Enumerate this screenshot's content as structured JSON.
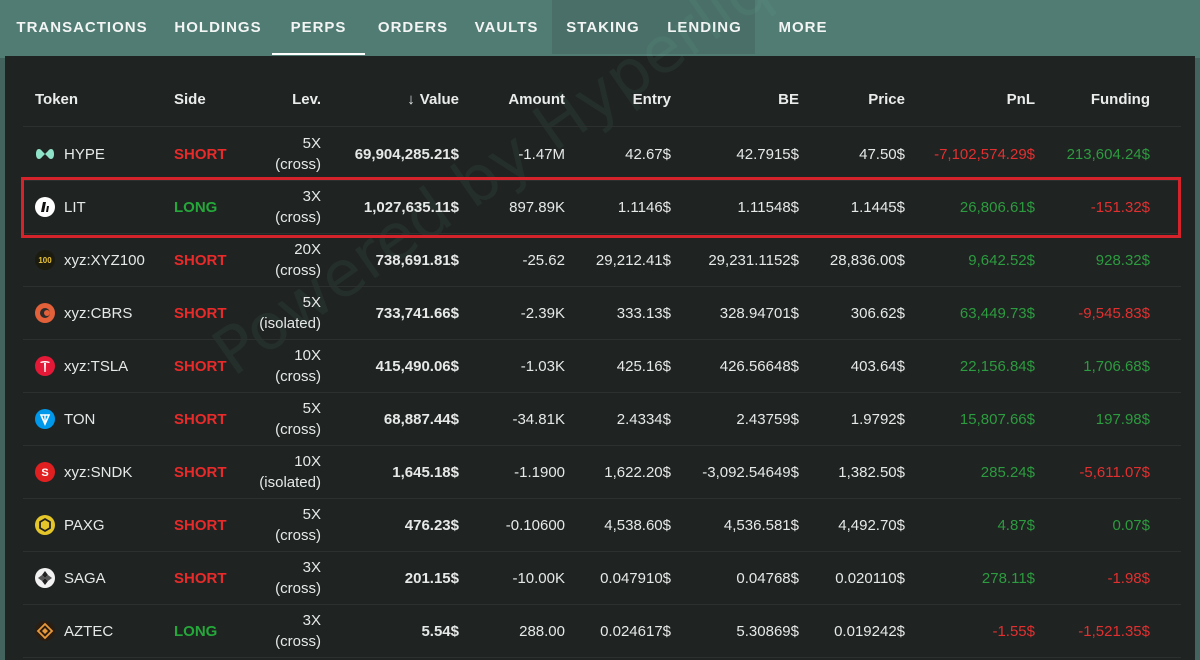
{
  "tabs": [
    {
      "label": "TRANSACTIONS"
    },
    {
      "label": "HOLDINGS"
    },
    {
      "label": "PERPS"
    },
    {
      "label": "ORDERS"
    },
    {
      "label": "VAULTS"
    },
    {
      "label": "STAKING"
    },
    {
      "label": "LENDING"
    },
    {
      "label": "MORE"
    }
  ],
  "active_tab": "PERPS",
  "watermark": "Powered by Hyperliquid",
  "columns": {
    "token": "Token",
    "side": "Side",
    "lev": "Lev.",
    "value": "Value",
    "amount": "Amount",
    "entry": "Entry",
    "be": "BE",
    "price": "Price",
    "pnl": "PnL",
    "funding": "Funding"
  },
  "colors": {
    "short": "#e82a2a",
    "long": "#25a83a",
    "highlight": "#d4232a"
  },
  "rows": [
    {
      "token": "HYPE",
      "icon": "hype-icon",
      "side": "SHORT",
      "lev": "5X",
      "mode": "(cross)",
      "value": "69,904,285.21$",
      "amount": "-1.47M",
      "entry": "42.67$",
      "be": "42.7915$",
      "price": "47.50$",
      "pnl": "-7,102,574.29$",
      "funding": "213,604.24$"
    },
    {
      "token": "LIT",
      "icon": "lit-icon",
      "side": "LONG",
      "lev": "3X",
      "mode": "(cross)",
      "value": "1,027,635.11$",
      "amount": "897.89K",
      "entry": "1.1146$",
      "be": "1.11548$",
      "price": "1.1445$",
      "pnl": "26,806.61$",
      "funding": "-151.32$"
    },
    {
      "token": "xyz:XYZ100",
      "icon": "xyz100-icon",
      "side": "SHORT",
      "lev": "20X",
      "mode": "(cross)",
      "value": "738,691.81$",
      "amount": "-25.62",
      "entry": "29,212.41$",
      "be": "29,231.1152$",
      "price": "28,836.00$",
      "pnl": "9,642.52$",
      "funding": "928.32$"
    },
    {
      "token": "xyz:CBRS",
      "icon": "cbrs-icon",
      "side": "SHORT",
      "lev": "5X",
      "mode": "(isolated)",
      "value": "733,741.66$",
      "amount": "-2.39K",
      "entry": "333.13$",
      "be": "328.94701$",
      "price": "306.62$",
      "pnl": "63,449.73$",
      "funding": "-9,545.83$"
    },
    {
      "token": "xyz:TSLA",
      "icon": "tesla-icon",
      "side": "SHORT",
      "lev": "10X",
      "mode": "(cross)",
      "value": "415,490.06$",
      "amount": "-1.03K",
      "entry": "425.16$",
      "be": "426.56648$",
      "price": "403.64$",
      "pnl": "22,156.84$",
      "funding": "1,706.68$"
    },
    {
      "token": "TON",
      "icon": "ton-icon",
      "side": "SHORT",
      "lev": "5X",
      "mode": "(cross)",
      "value": "68,887.44$",
      "amount": "-34.81K",
      "entry": "2.4334$",
      "be": "2.43759$",
      "price": "1.9792$",
      "pnl": "15,807.66$",
      "funding": "197.98$"
    },
    {
      "token": "xyz:SNDK",
      "icon": "sndk-icon",
      "side": "SHORT",
      "lev": "10X",
      "mode": "(isolated)",
      "value": "1,645.18$",
      "amount": "-1.1900",
      "entry": "1,622.20$",
      "be": "-3,092.54649$",
      "price": "1,382.50$",
      "pnl": "285.24$",
      "funding": "-5,611.07$"
    },
    {
      "token": "PAXG",
      "icon": "paxg-icon",
      "side": "SHORT",
      "lev": "5X",
      "mode": "(cross)",
      "value": "476.23$",
      "amount": "-0.10600",
      "entry": "4,538.60$",
      "be": "4,536.581$",
      "price": "4,492.70$",
      "pnl": "4.87$",
      "funding": "0.07$"
    },
    {
      "token": "SAGA",
      "icon": "saga-icon",
      "side": "SHORT",
      "lev": "3X",
      "mode": "(cross)",
      "value": "201.15$",
      "amount": "-10.00K",
      "entry": "0.047910$",
      "be": "0.04768$",
      "price": "0.020110$",
      "pnl": "278.11$",
      "funding": "-1.98$"
    },
    {
      "token": "AZTEC",
      "icon": "aztec-icon",
      "side": "LONG",
      "lev": "3X",
      "mode": "(cross)",
      "value": "5.54$",
      "amount": "288.00",
      "entry": "0.024617$",
      "be": "5.30869$",
      "price": "0.019242$",
      "pnl": "-1.55$",
      "funding": "-1,521.35$"
    }
  ]
}
